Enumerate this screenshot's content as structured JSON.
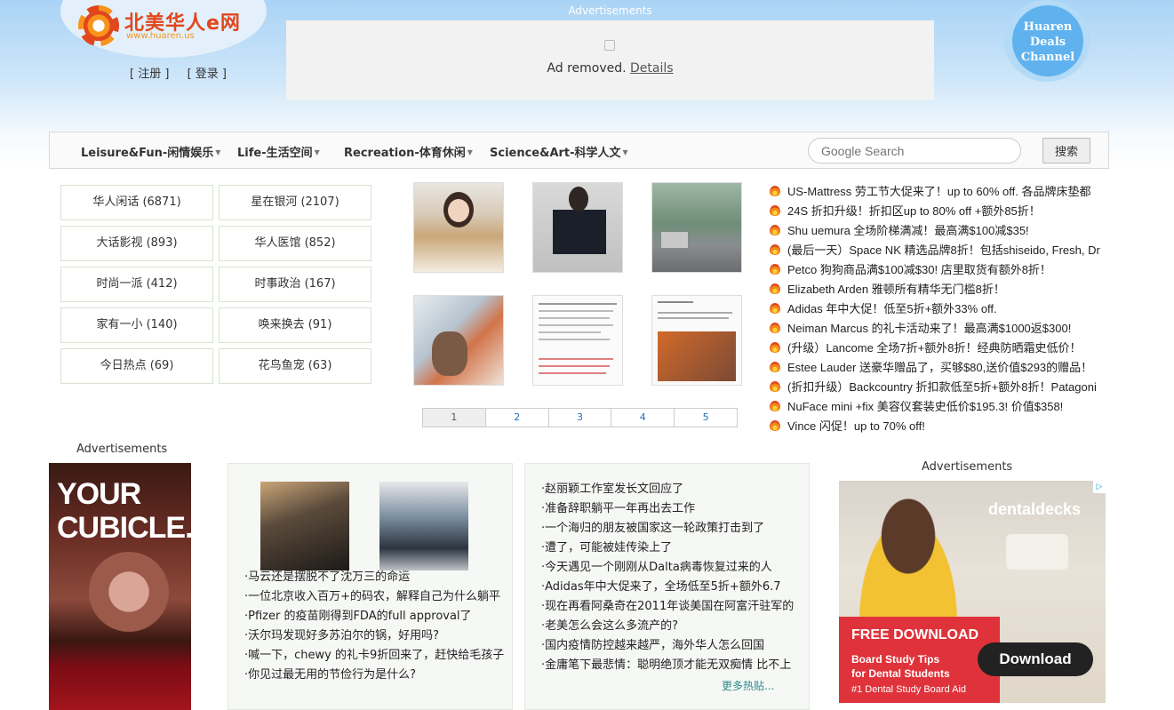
{
  "header": {
    "logo_text": "北美华人e网",
    "logo_url_text": "www.huaren.us",
    "register_label": "[ 注册 ]",
    "login_label": "[ 登录 ]",
    "ad_label": "Advertisements",
    "ad_removed_text": "Ad removed.",
    "ad_details_link": "Details",
    "deals_channel": [
      "Huaren",
      "Deals",
      "Channel"
    ]
  },
  "nav": {
    "items": [
      "Leisure&Fun-闲情娱乐",
      "Life-生活空间",
      "Recreation-体育休闲",
      "Science&Art-科学人文"
    ],
    "search_placeholder": "Google Search",
    "search_button": "搜索"
  },
  "categories": [
    "华人闲话 (6871)",
    "星在银河 (2107)",
    "大话影视 (893)",
    "华人医馆 (852)",
    "时尚一派 (412)",
    "时事政治 (167)",
    "家有一小 (140)",
    "唤来换去 (91)",
    "今日热点 (69)",
    "花鸟鱼宠 (63)"
  ],
  "pager": [
    "1",
    "2",
    "3",
    "4",
    "5"
  ],
  "deals": [
    "US-Mattress 劳工节大促来了！up to 60% off. 各品牌床垫都",
    "24S 折扣升级！折扣区up to 80% off +额外85折！",
    "Shu uemura 全场阶梯满减！最高满$100减$35!",
    "(最后一天）Space NK 精选品牌8折！包括shiseido, Fresh, Dr",
    "Petco 狗狗商品满$100减$30! 店里取货有额外8折！",
    "Elizabeth Arden 雅顿所有精华无门槛8折！",
    "Adidas 年中大促！低至5折+额外33% off.",
    "Neiman Marcus 的礼卡活动来了！最高满$1000返$300!",
    "(升级）Lancome 全场7折+额外8折！经典防晒霜史低价！",
    "Estee Lauder 送豪华赠品了，买够$80,送价值$293的赠品！",
    "(折扣升级）Backcountry 折扣款低至5折+额外8折！Patagoni",
    "NuFace mini +fix 美容仪套装史低价$195.3! 价值$358!",
    "Vince 闪促！up to 70% off!"
  ],
  "ads": {
    "left_label": "Advertisements",
    "left_text": [
      "YOUR",
      "CUBICLE."
    ],
    "right_label": "Advertisements",
    "right_brand": "dentaldecks",
    "right_free": "FREE DOWNLOAD",
    "right_tips": [
      "Board Study Tips",
      "for Dental Students"
    ],
    "right_aid": "#1 Dental Study Board Aid",
    "right_button": "Download"
  },
  "news_left": [
    "·马云还是摆脱不了沈万三的命运",
    "·一位北京收入百万+的码农，解释自己为什么躺平",
    "·Pfizer 的疫苗刚得到FDA的full approval了",
    "·沃尔玛发现好多苏泊尔的锅，好用吗?",
    "·喊一下，chewy 的礼卡9折回来了，赶快给毛孩子",
    "·你见过最无用的节俭行为是什么?"
  ],
  "news_right": [
    "·赵丽颖工作室发长文回应了",
    "·准备辞职躺平一年再出去工作",
    "·一个海归的朋友被国家这一轮政策打击到了",
    "·遭了，可能被娃传染上了",
    "·今天遇见一个刚刚从Dalta病毒恢复过来的人",
    "·Adidas年中大促来了，全场低至5折+额外6.7",
    "·现在再看阿桑奇在2011年谈美国在阿富汗驻军的",
    "·老美怎么会这么多流产的?",
    "·国内疫情防控越来越严，海外华人怎么回国",
    "·金庸笔下最悲情：聪明绝顶才能无双痴情 比不上"
  ],
  "more_link": "更多热贴..."
}
